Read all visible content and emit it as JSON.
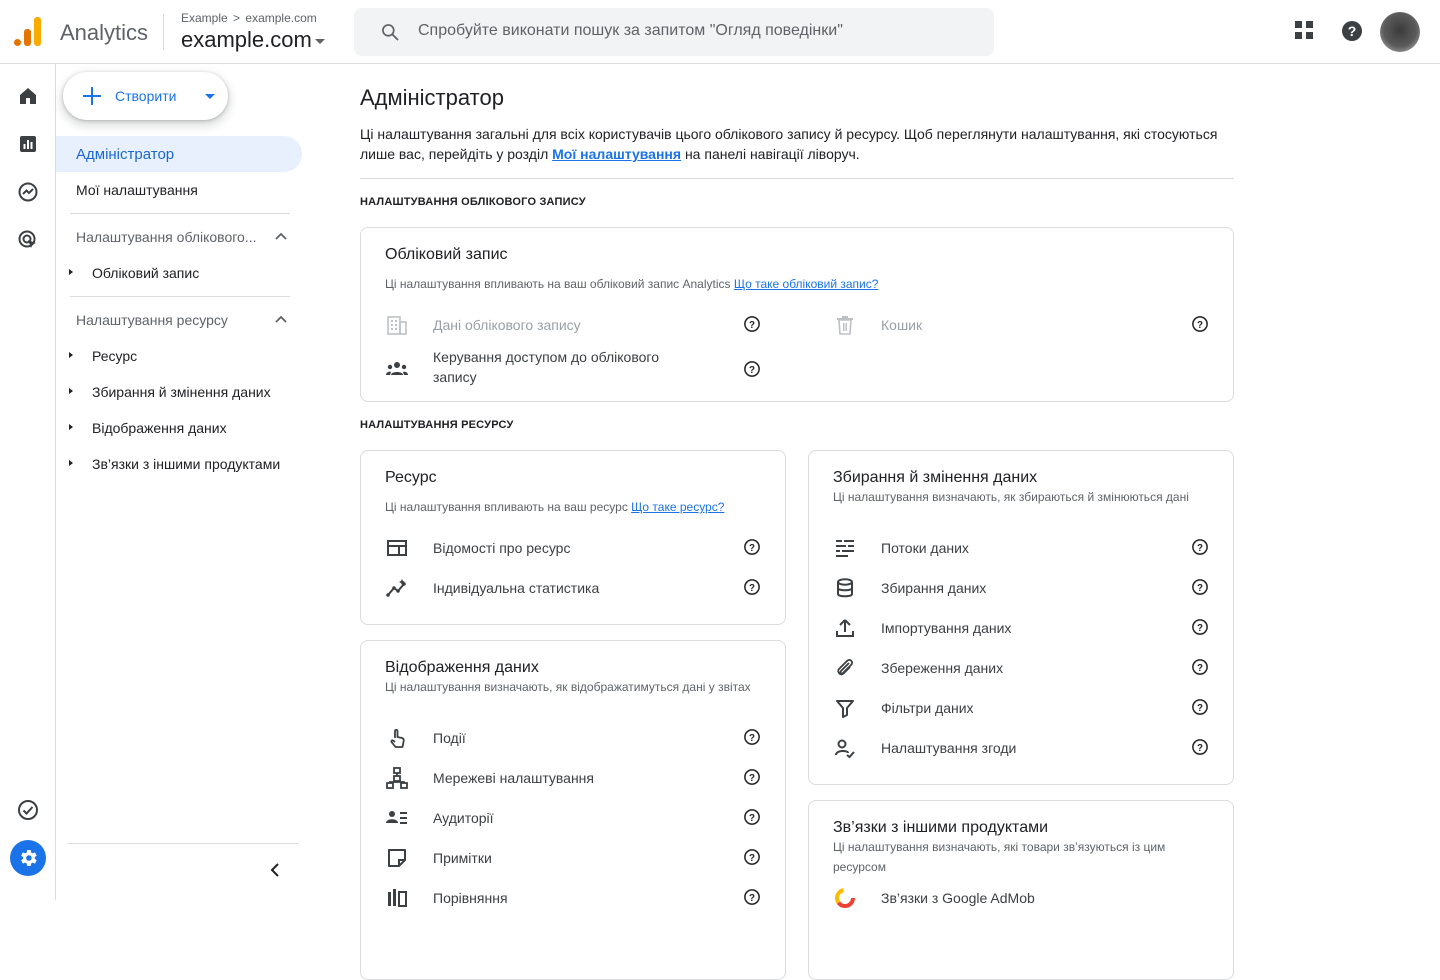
{
  "header": {
    "app_name": "Analytics",
    "breadcrumb_parent": "Example",
    "breadcrumb_child": "example.com",
    "property_name": "example.com",
    "search_placeholder": "Спробуйте виконати пошук за запитом \"Огляд поведінки\""
  },
  "nav": {
    "create_label": "Створити",
    "active_item": "Адміністратор",
    "my_settings": "Мої налаштування",
    "account_section": "Налаштування облікового...",
    "account_items": [
      "Обліковий запис"
    ],
    "property_section": "Налаштування ресурсу",
    "property_items": [
      "Ресурс",
      "Збирання й змінення даних",
      "Відображення даних",
      "Зв’язки з іншими продуктами"
    ]
  },
  "main": {
    "title": "Адміністратор",
    "intro_text_1": "Ці налаштування загальні для всіх користувачів цього облікового запису й ресурсу. Щоб переглянути налаштування, які стосуються лише вас, перейдіть у розділ ",
    "intro_link": "Мої налаштування",
    "intro_text_2": " на панелі навігації ліворуч.",
    "account_section_title": "НАЛАШТУВАННЯ ОБЛІКОВОГО ЗАПИСУ",
    "property_section_title": "НАЛАШТУВАННЯ РЕСУРСУ"
  },
  "cards": {
    "account": {
      "title": "Обліковий запис",
      "desc": "Ці налаштування впливають на ваш обліковий запис Analytics ",
      "desc_link": "Що таке обліковий запис?",
      "items": [
        {
          "label": "Дані облікового запису",
          "icon": "building-icon"
        },
        {
          "label": "Кошик",
          "icon": "trash-icon"
        },
        {
          "label": "Керування доступом до облікового запису",
          "icon": "group-icon"
        }
      ]
    },
    "property": {
      "title": "Ресурс",
      "desc": "Ці налаштування впливають на ваш ресурс ",
      "desc_link": "Що таке ресурс?",
      "items": [
        {
          "label": "Відомості про ресурс",
          "icon": "web-icon"
        },
        {
          "label": "Індивідуальна статистика",
          "icon": "insights-icon"
        }
      ]
    },
    "collection": {
      "title": "Збирання й змінення даних",
      "desc": "Ці налаштування визначають, як збираються й змінюються дані",
      "items": [
        {
          "label": "Потоки даних",
          "icon": "streams-icon"
        },
        {
          "label": "Збирання даних",
          "icon": "database-icon"
        },
        {
          "label": "Імпортування даних",
          "icon": "upload-icon"
        },
        {
          "label": "Збереження даних",
          "icon": "paperclip-icon"
        },
        {
          "label": "Фільтри даних",
          "icon": "filter-icon"
        },
        {
          "label": "Налаштування згоди",
          "icon": "person-check-icon"
        }
      ]
    },
    "display": {
      "title": "Відображення даних",
      "desc": "Ці налаштування визначають, як відображатимуться дані у звітах",
      "items": [
        {
          "label": "Події",
          "icon": "touch-icon"
        },
        {
          "label": "Мережеві налаштування",
          "icon": "sitemap-icon"
        },
        {
          "label": "Аудиторії",
          "icon": "audience-icon"
        },
        {
          "label": "Примітки",
          "icon": "note-icon"
        },
        {
          "label": "Порівняння",
          "icon": "compare-icon"
        }
      ]
    },
    "links": {
      "title": "Зв’язки з іншими продуктами",
      "desc": "Ці налаштування визначають, які товари зв’язуються із цим ресурсом",
      "items": [
        {
          "label": "Зв’язки з Google AdMob",
          "icon": "admob-icon"
        }
      ]
    }
  },
  "colors": {
    "accent": "#1a73e8",
    "logo_orange": "#e37400",
    "logo_yellow": "#f9ab00",
    "active_bg": "#e8f0fe"
  }
}
